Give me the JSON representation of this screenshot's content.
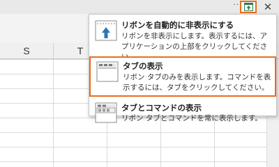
{
  "toolbar": {
    "more_label": "···",
    "close_label": "✕"
  },
  "sheet": {
    "columns": [
      "S",
      "T"
    ]
  },
  "ribbon_menu": {
    "options": [
      {
        "title": "リボンを自動的に非表示にする",
        "description": "リボンを非表示にします。表示するには、アプリケーションの上部をクリックしてください。",
        "icon": "auto-hide-ribbon-icon",
        "selected": false
      },
      {
        "title": "タブの表示",
        "description": "リボン タブのみを表示します。コマンドを表示するには、タブをクリックしてください。",
        "icon": "show-tabs-icon",
        "selected": true
      },
      {
        "title": "タブとコマンドの表示",
        "description": "リボン タブとコマンドを常に表示します。",
        "icon": "show-tabs-and-commands-icon",
        "selected": false
      }
    ]
  },
  "colors": {
    "highlight": "#ea6c1b",
    "accent_blue": "#2e75b6"
  }
}
